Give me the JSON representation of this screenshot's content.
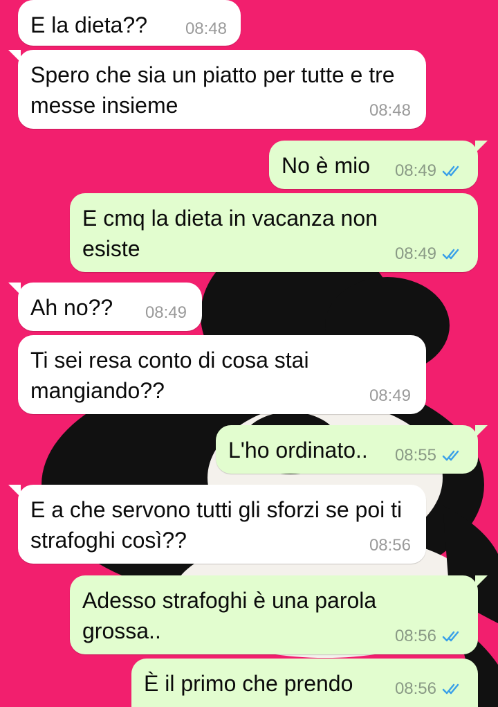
{
  "colors": {
    "wallpaper": "#f21f6e",
    "incoming_bubble": "#ffffff",
    "outgoing_bubble": "#e2fdcf",
    "read_ticks": "#3aa0e8"
  },
  "messages": [
    {
      "direction": "in",
      "text": "E la dieta??",
      "time": "08:48"
    },
    {
      "direction": "in",
      "text": "Spero che sia un piatto per tutte e tre messe insieme",
      "time": "08:48"
    },
    {
      "direction": "out",
      "text": "No è mio",
      "time": "08:49",
      "status": "read-double-tick-icon"
    },
    {
      "direction": "out",
      "text": "E cmq la dieta in vacanza non esiste",
      "time": "08:49",
      "status": "read-double-tick-icon"
    },
    {
      "direction": "in",
      "text": "Ah no??",
      "time": "08:49"
    },
    {
      "direction": "in",
      "text": "Ti sei resa conto di cosa stai mangiando??",
      "time": "08:49"
    },
    {
      "direction": "out",
      "text": "L'ho ordinato..",
      "time": "08:55",
      "status": "read-double-tick-icon"
    },
    {
      "direction": "in",
      "text": "E a che servono tutti gli sforzi se poi ti strafoghi così??",
      "time": "08:56"
    },
    {
      "direction": "out",
      "text": "Adesso strafoghi è una parola grossa..",
      "time": "08:56",
      "status": "read-double-tick-icon"
    },
    {
      "direction": "out",
      "text": "È il primo che prendo",
      "time": "08:56",
      "status": "read-double-tick-icon"
    }
  ]
}
